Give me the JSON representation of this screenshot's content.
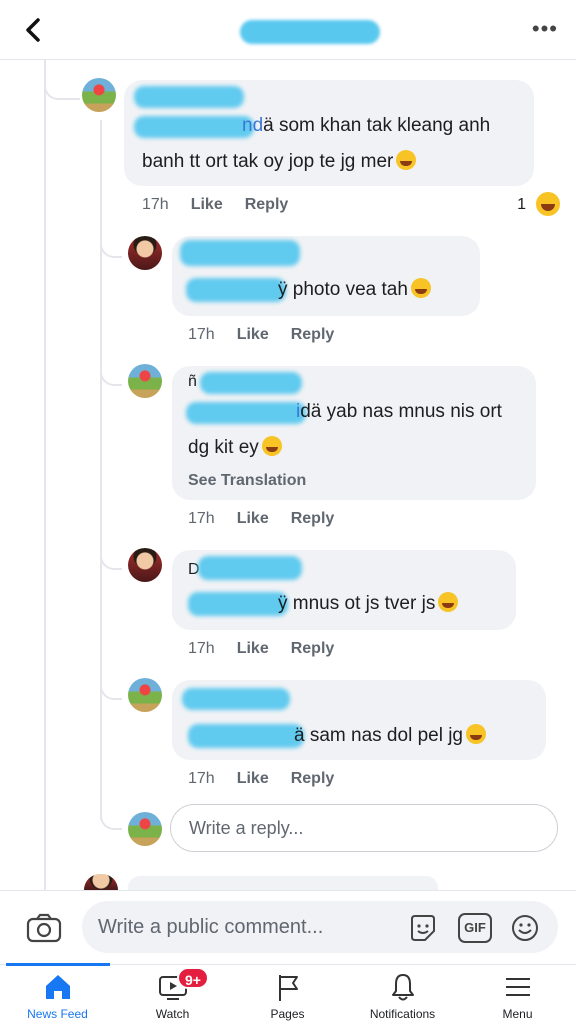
{
  "header": {
    "back_icon": "chevron-left-icon",
    "more_icon": "more-horizontal-icon",
    "more_label": "•••"
  },
  "thread": {
    "top_comment": {
      "text_end": "ä som khan tak kleang anh",
      "text_line2": "banh tt ort tak oy jop te jg mer",
      "emoji": "laughing-emoji",
      "time": "17h",
      "like": "Like",
      "reply": "Reply",
      "reaction_count": "1",
      "reaction_emoji": "haha-reaction-icon"
    },
    "replies": [
      {
        "author_initial": "",
        "text_end": "ÿ photo vea tah",
        "text_line2": "",
        "emoji": "laughing-emoji",
        "time": "17h",
        "like": "Like",
        "reply": "Reply"
      },
      {
        "author_initial": "ñ",
        "text_end": "dä yab nas mnus nis ort",
        "text_line2": "dg kit ey",
        "emoji": "rofl-emoji",
        "see_translation": "See Translation",
        "time": "17h",
        "like": "Like",
        "reply": "Reply"
      },
      {
        "author_initial": "D",
        "text_end": "ÿ mnus ot js tver js",
        "text_line2": "",
        "emoji": "crying-emoji",
        "time": "17h",
        "like": "Like",
        "reply": "Reply"
      },
      {
        "author_initial": "",
        "text_end": "ä sam nas dol pel jg",
        "text_line2": "",
        "emoji": "weary-emoji",
        "time": "17h",
        "like": "Like",
        "reply": "Reply"
      }
    ],
    "reply_placeholder": "Write a reply..."
  },
  "composer": {
    "placeholder": "Write a public comment...",
    "gif_label": "GIF"
  },
  "tabs": [
    {
      "label": "News Feed",
      "icon": "home-icon",
      "active": true
    },
    {
      "label": "Watch",
      "icon": "watch-icon",
      "badge": "9+"
    },
    {
      "label": "Pages",
      "icon": "flag-icon"
    },
    {
      "label": "Notifications",
      "icon": "bell-icon"
    },
    {
      "label": "Menu",
      "icon": "menu-icon"
    }
  ],
  "colors": {
    "accent": "#1877f2",
    "badge": "#e41e3f",
    "redaction": "#59c8ef"
  }
}
